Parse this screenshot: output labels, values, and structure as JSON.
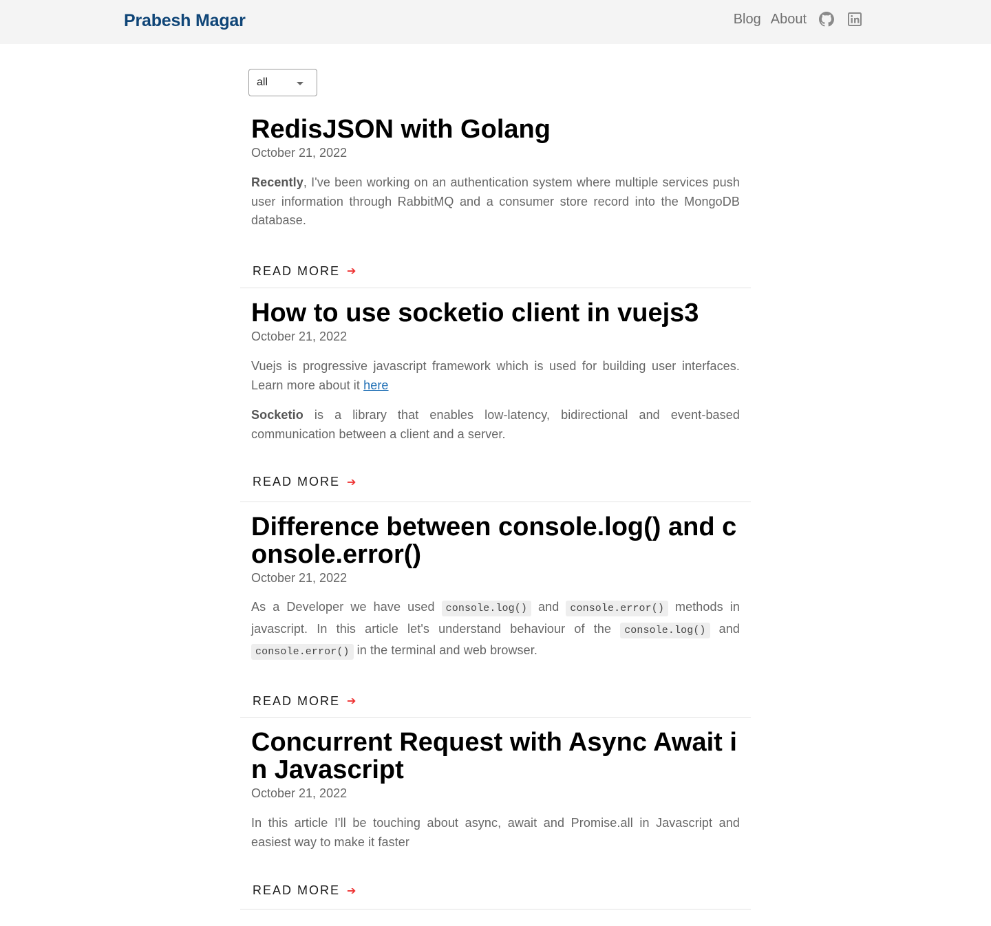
{
  "header": {
    "brand": "Prabesh Magar",
    "nav": [
      {
        "label": "Blog"
      },
      {
        "label": "About"
      }
    ],
    "icons": [
      "github-icon",
      "linkedin-icon"
    ]
  },
  "filter": {
    "selected": "all"
  },
  "read_more_label": "READ MORE",
  "posts": [
    {
      "title": "RedisJSON with Golang",
      "date": "October 21, 2022",
      "p1_bold": "Recently",
      "p1_rest": ", I've been working on an authentication system where multiple services push user information through RabbitMQ and a consumer store record into the MongoDB database."
    },
    {
      "title": "How to use socketio client in vuejs3",
      "date": "October 21, 2022",
      "p1_text": "Vuejs is progressive javascript framework which is used for building user interfaces. Learn more about it ",
      "p1_link": "here",
      "p2_bold": "Socketio",
      "p2_rest": " is a library that enables low-latency, bidirectional and event-based communication between a client and a server."
    },
    {
      "title": "Difference between console.log() and console.error()",
      "date": "October 21, 2022",
      "t1": "As a Developer we have used ",
      "c1": "console.log()",
      "t2": " and ",
      "c2": "console.error()",
      "t3": " methods in javascript. In this article let's understand behaviour of the ",
      "c3": "console.log()",
      "t4": " and ",
      "c4": "console.error()",
      "t5": " in the terminal and web browser."
    },
    {
      "title": "Concurrent Request with Async Await in Javascript",
      "date": "October 21, 2022",
      "p1": "In this article I'll be touching about async, await and Promise.all in Javascript and easiest way to make it faster"
    }
  ]
}
